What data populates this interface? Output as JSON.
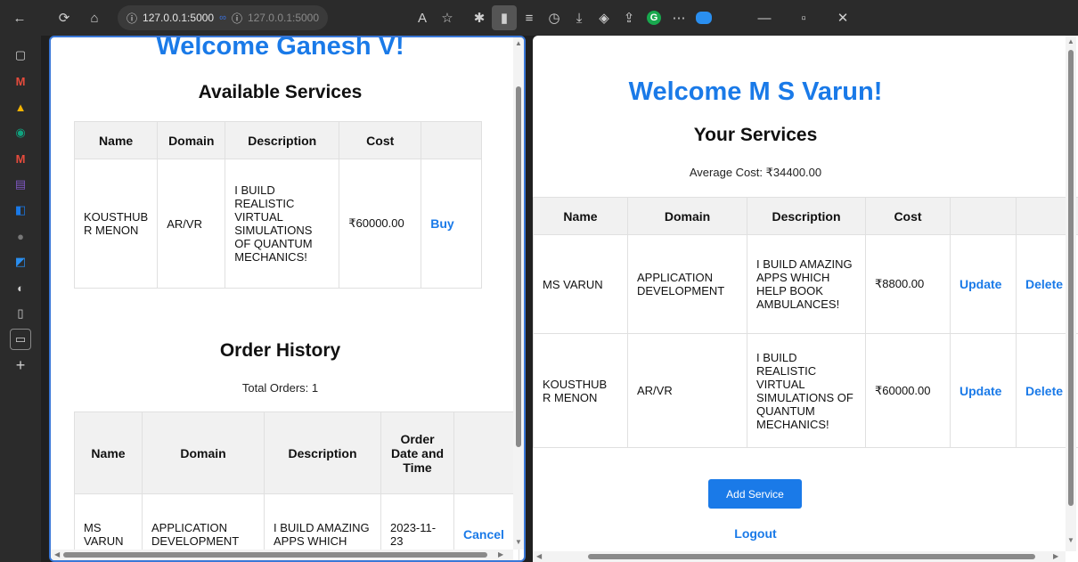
{
  "browser": {
    "url_left": "127.0.0.1:5000",
    "url_right": "127.0.0.1:5000"
  },
  "left": {
    "welcome": "Welcome Ganesh V!",
    "available_title": "Available Services",
    "available_headers": [
      "Name",
      "Domain",
      "Description",
      "Cost",
      ""
    ],
    "available_rows": [
      {
        "name": "KOUSTHUB R MENON",
        "domain": "AR/VR",
        "description": "I BUILD REALISTIC VIRTUAL SIMULATIONS OF QUANTUM MECHANICS!",
        "cost": "₹60000.00",
        "action": "Buy"
      }
    ],
    "history_title": "Order History",
    "total_orders": "Total Orders: 1",
    "history_headers": [
      "Name",
      "Domain",
      "Description",
      "Order Date and Time",
      ""
    ],
    "history_rows": [
      {
        "name": "MS VARUN",
        "domain": "APPLICATION DEVELOPMENT",
        "description": "I BUILD AMAZING APPS WHICH",
        "date": "2023-11-23",
        "action": "Cancel"
      }
    ]
  },
  "right": {
    "welcome": "Welcome M S Varun!",
    "services_title": "Your Services",
    "average_cost": "Average Cost: ₹34400.00",
    "headers": [
      "Name",
      "Domain",
      "Description",
      "Cost",
      "",
      ""
    ],
    "rows": [
      {
        "name": "MS VARUN",
        "domain": "APPLICATION DEVELOPMENT",
        "description": "I BUILD AMAZING APPS WHICH HELP BOOK AMBULANCES!",
        "cost": "₹8800.00",
        "update": "Update",
        "delete": "Delete"
      },
      {
        "name": "KOUSTHUB R MENON",
        "domain": "AR/VR",
        "description": "I BUILD REALISTIC VIRTUAL SIMULATIONS OF QUANTUM MECHANICS!",
        "cost": "₹60000.00",
        "update": "Update",
        "delete": "Delete"
      }
    ],
    "add_service": "Add Service",
    "logout": "Logout"
  }
}
